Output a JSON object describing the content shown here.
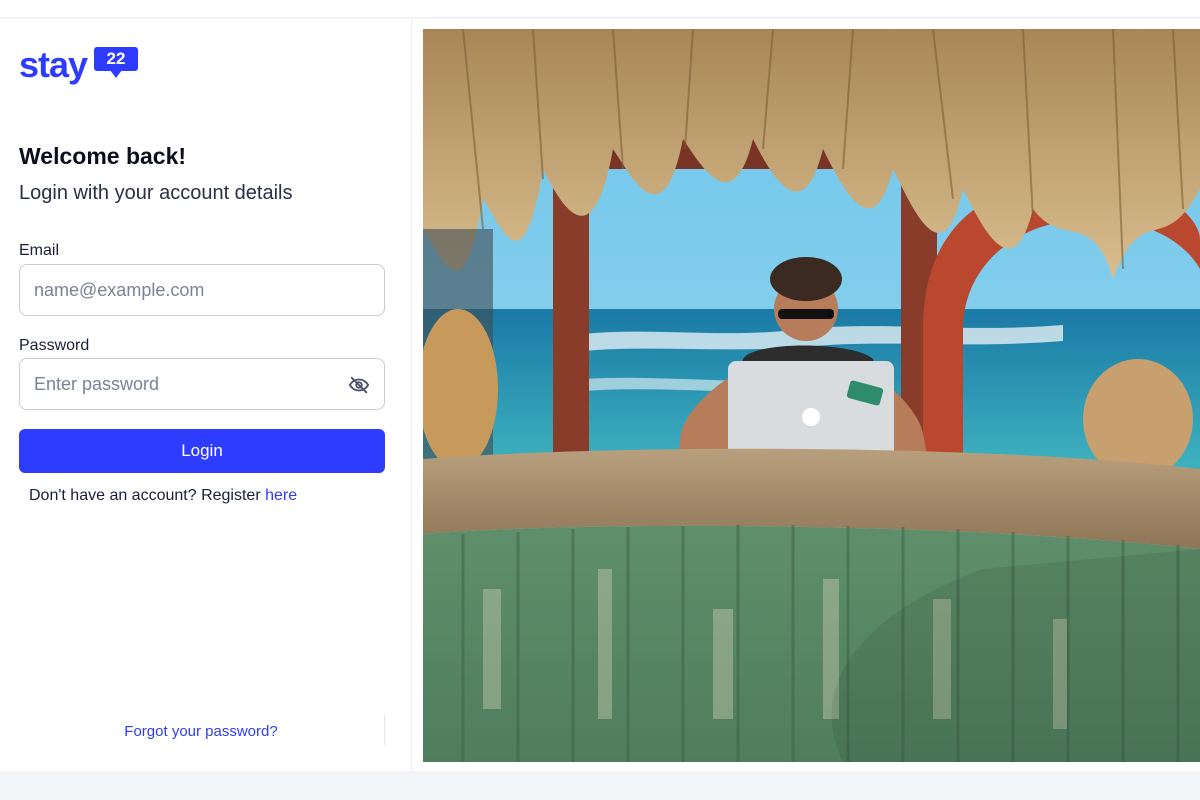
{
  "brand": {
    "logo_word": "stay",
    "logo_number": "22",
    "accent": "#2e3cff"
  },
  "heading": {
    "title": "Welcome back!",
    "subtitle": "Login with your account details"
  },
  "form": {
    "email_label": "Email",
    "email_placeholder": "name@example.com",
    "password_label": "Password",
    "password_placeholder": "Enter password",
    "password_toggle_icon": "eye-off-icon",
    "login_label": "Login"
  },
  "register": {
    "prompt": "Don't have an account? Register ",
    "link": "here"
  },
  "forgot": {
    "link": "Forgot your password?"
  },
  "hero": {
    "description_icon": "beach-bar-photo",
    "laptop_sticker": "Deya Bela"
  }
}
